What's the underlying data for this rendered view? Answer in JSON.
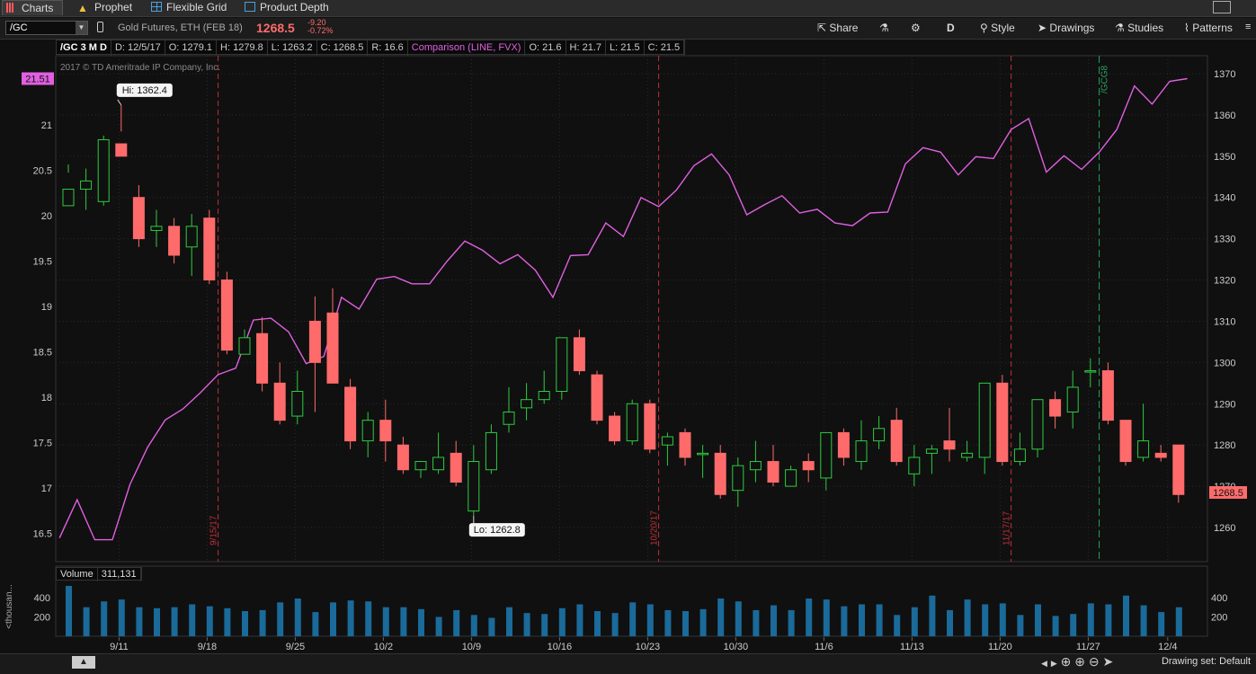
{
  "tabs": [
    {
      "label": "Charts",
      "icon": "bar-chart-icon"
    },
    {
      "label": "Prophet",
      "icon": "warning-triangle-icon"
    },
    {
      "label": "Flexible Grid",
      "icon": "grid-icon"
    },
    {
      "label": "Product Depth",
      "icon": "depth-icon"
    }
  ],
  "toolbar": {
    "symbol": "/GC",
    "description": "Gold Futures, ETH (FEB 18)",
    "last": "1268.5",
    "change": "-9.20",
    "change_pct": "-0.72%",
    "share": "Share",
    "period": "D",
    "style": "Style",
    "drawings": "Drawings",
    "studies": "Studies",
    "patterns": "Patterns"
  },
  "infobar": {
    "symbol": "/GC 3 M D",
    "date": "D: 12/5/17",
    "open": "O: 1279.1",
    "high": "H: 1279.8",
    "low": "L: 1263.2",
    "close": "C: 1268.5",
    "range": "R: 16.6",
    "comparison": "Comparison (LINE, FVX)",
    "c_open": "O: 21.6",
    "c_high": "H: 21.7",
    "c_low": "L: 21.5",
    "c_close": "C: 21.5"
  },
  "copyright": "2017 © TD Ameritrade IP Company, Inc.",
  "volume": {
    "label": "Volume",
    "value": "311,131",
    "axis_label": "<thousan..."
  },
  "statusbar": {
    "drawing_set": "Drawing set: Default"
  },
  "colors": {
    "up": "#2ecc40",
    "down": "#ff6b6b",
    "comparison": "#e060e0",
    "volume": "#1a6a9a",
    "marker": "#c0303a",
    "expiry": "#2aa060"
  },
  "chart_data": {
    "type": "candlestick",
    "title": "/GC 3 M D",
    "right_axis": {
      "ticks": [
        1260,
        1270,
        1280,
        1290,
        1300,
        1310,
        1320,
        1330,
        1340,
        1350,
        1360,
        1370
      ]
    },
    "left_axis": {
      "ticks": [
        "16.5",
        "17",
        "17.5",
        "18",
        "18.5",
        "19",
        "19.5",
        "20",
        "20.5",
        "21"
      ]
    },
    "x_ticks": [
      "9/11",
      "9/18",
      "9/25",
      "10/2",
      "10/9",
      "10/16",
      "10/23",
      "10/30",
      "11/6",
      "11/13",
      "11/20",
      "11/27",
      "12/4"
    ],
    "price_label": "1268.5",
    "comparison_label": "21.51",
    "high_label": "Hi: 1362.4",
    "low_label": "Lo: 1262.8",
    "markers": [
      "9/15/17",
      "10/20/17",
      "11/17/17"
    ],
    "expiry_label": "/GCG8",
    "candles": [
      [
        1338,
        1346,
        1342,
        1348
      ],
      [
        1342,
        1347,
        1344,
        1337
      ],
      [
        1339,
        1355,
        1354,
        1338
      ],
      [
        1353,
        1362.4,
        1350,
        1356
      ],
      [
        1340,
        1343,
        1330,
        1328
      ],
      [
        1332,
        1337,
        1333,
        1328
      ],
      [
        1333,
        1335,
        1326,
        1324
      ],
      [
        1328,
        1336,
        1333,
        1321
      ],
      [
        1335,
        1337,
        1320,
        1319
      ],
      [
        1320,
        1322,
        1303,
        1302
      ],
      [
        1302,
        1308,
        1306,
        1302
      ],
      [
        1307,
        1311,
        1295,
        1293
      ],
      [
        1295,
        1300,
        1286,
        1285
      ],
      [
        1287,
        1298,
        1293,
        1285
      ],
      [
        1310,
        1316,
        1300,
        1288
      ],
      [
        1312,
        1318,
        1295,
        1296
      ],
      [
        1294,
        1296,
        1281,
        1279
      ],
      [
        1281,
        1288,
        1286,
        1277
      ],
      [
        1286,
        1291,
        1281,
        1276
      ],
      [
        1280,
        1282,
        1274,
        1273
      ],
      [
        1274,
        1276,
        1276,
        1272
      ],
      [
        1274,
        1283,
        1277,
        1273
      ],
      [
        1278,
        1281,
        1271,
        1270
      ],
      [
        1264,
        1280,
        1276,
        1262.8
      ],
      [
        1274,
        1285,
        1283,
        1273
      ],
      [
        1285,
        1294,
        1288,
        1283
      ],
      [
        1289,
        1295,
        1291,
        1286
      ],
      [
        1291,
        1298,
        1293,
        1290
      ],
      [
        1293,
        1306,
        1306,
        1291
      ],
      [
        1306,
        1308,
        1298,
        1297
      ],
      [
        1297,
        1298,
        1286,
        1285
      ],
      [
        1287,
        1288,
        1281,
        1280
      ],
      [
        1281,
        1291,
        1290,
        1280
      ],
      [
        1290,
        1291,
        1279,
        1278
      ],
      [
        1280,
        1283,
        1282,
        1275
      ],
      [
        1283,
        1284,
        1277,
        1275
      ],
      [
        1278,
        1280,
        1278,
        1272
      ],
      [
        1278,
        1280,
        1268,
        1267
      ],
      [
        1269,
        1277,
        1275,
        1265
      ],
      [
        1274,
        1281,
        1276,
        1271
      ],
      [
        1276,
        1280,
        1271,
        1270
      ],
      [
        1270,
        1275,
        1274,
        1270
      ],
      [
        1276,
        1278,
        1274,
        1271
      ],
      [
        1272,
        1282,
        1283,
        1269
      ],
      [
        1283,
        1284,
        1277,
        1275
      ],
      [
        1276,
        1286,
        1281,
        1274
      ],
      [
        1281,
        1287,
        1284,
        1279
      ],
      [
        1286,
        1289,
        1276,
        1275
      ],
      [
        1273,
        1280,
        1277,
        1270
      ],
      [
        1278,
        1280,
        1279,
        1273
      ],
      [
        1281,
        1289,
        1279,
        1276
      ],
      [
        1277,
        1281,
        1278,
        1276
      ],
      [
        1277,
        1295,
        1295,
        1273
      ],
      [
        1295,
        1297,
        1276,
        1275
      ],
      [
        1276,
        1283,
        1279,
        1275
      ],
      [
        1279,
        1291,
        1291,
        1277
      ],
      [
        1291,
        1293,
        1287,
        1284
      ],
      [
        1288,
        1298,
        1294,
        1284
      ],
      [
        1298,
        1301,
        1298,
        1294
      ],
      [
        1298,
        1300,
        1286,
        1285
      ],
      [
        1286,
        1286,
        1276,
        1275
      ],
      [
        1277,
        1290,
        1281,
        1276
      ],
      [
        1278,
        1280,
        1277,
        1276
      ],
      [
        1280,
        1280,
        1268,
        1266
      ]
    ],
    "comparison": [
      16.45,
      16.87,
      16.43,
      16.43,
      17.04,
      17.45,
      17.75,
      17.87,
      18.05,
      18.25,
      18.32,
      18.85,
      18.87,
      18.72,
      18.37,
      18.45,
      19.1,
      18.97,
      19.3,
      19.33,
      19.25,
      19.25,
      19.5,
      19.72,
      19.62,
      19.47,
      19.57,
      19.4,
      19.1,
      19.56,
      19.57,
      19.92,
      19.77,
      20.2,
      20.1,
      20.28,
      20.55,
      20.68,
      20.45,
      20.01,
      20.12,
      20.22,
      20.03,
      20.07,
      19.92,
      19.89,
      20.03,
      20.04,
      20.57,
      20.75,
      20.7,
      20.45,
      20.65,
      20.63,
      20.95,
      21.07,
      20.48,
      20.66,
      20.51,
      20.7,
      20.95,
      21.43,
      21.23,
      21.48,
      21.51
    ],
    "volumes": [
      520,
      300,
      360,
      380,
      300,
      290,
      300,
      330,
      310,
      290,
      260,
      270,
      350,
      390,
      250,
      350,
      370,
      360,
      300,
      300,
      280,
      200,
      270,
      220,
      190,
      300,
      240,
      230,
      290,
      330,
      260,
      240,
      350,
      330,
      270,
      260,
      280,
      390,
      360,
      270,
      320,
      270,
      390,
      380,
      310,
      330,
      330,
      220,
      300,
      420,
      270,
      380,
      330,
      340,
      220,
      330,
      210,
      230,
      340,
      330,
      420,
      320,
      250,
      300
    ]
  }
}
